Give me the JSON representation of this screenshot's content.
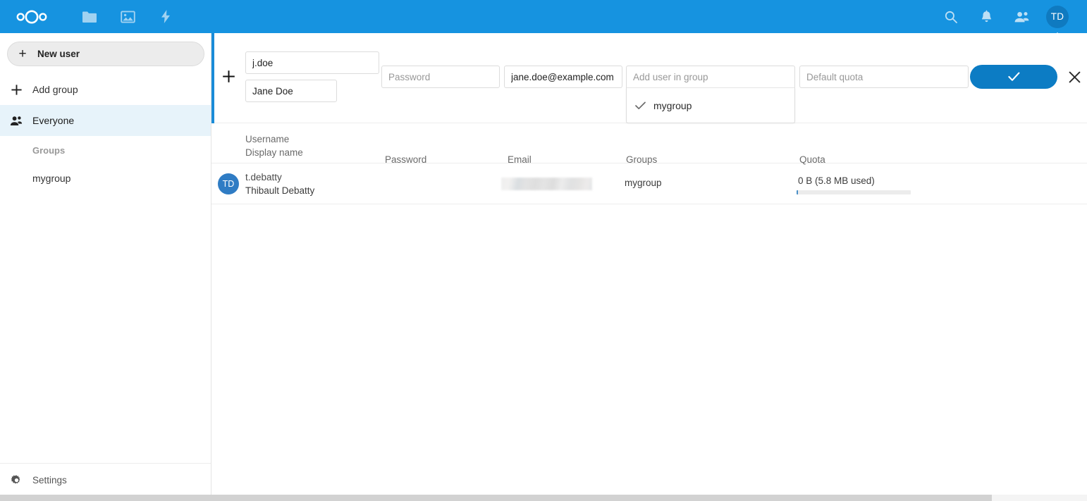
{
  "header": {
    "logo": "nextcloud-logo",
    "apps": [
      {
        "name": "files-app-icon",
        "label": "Files"
      },
      {
        "name": "photos-app-icon",
        "label": "Photos"
      },
      {
        "name": "activity-app-icon",
        "label": "Activity"
      }
    ],
    "actions": [
      {
        "name": "search-icon",
        "label": "Search"
      },
      {
        "name": "notifications-bell-icon",
        "label": "Notifications"
      },
      {
        "name": "contacts-icon",
        "label": "Contacts"
      }
    ],
    "avatar_initials": "TD"
  },
  "sidebar": {
    "new_user_label": "New user",
    "add_group_label": "Add group",
    "everyone_label": "Everyone",
    "groups_heading": "Groups",
    "groups": [
      {
        "label": "mygroup"
      }
    ],
    "settings_label": "Settings"
  },
  "form": {
    "username": {
      "value": "j.doe",
      "placeholder": "Username"
    },
    "displayname": {
      "value": "Jane Doe",
      "placeholder": "Display name"
    },
    "password": {
      "value": "",
      "placeholder": "Password"
    },
    "email": {
      "value": "jane.doe@example.com",
      "placeholder": "Email"
    },
    "group": {
      "value": "",
      "placeholder": "Add user in group"
    },
    "quota": {
      "value": "",
      "placeholder": "Default quota"
    },
    "dropdown_options": [
      {
        "label": "mygroup",
        "selected": true
      }
    ],
    "submit_icon": "check-icon",
    "close_icon": "close-icon"
  },
  "table": {
    "headers": {
      "username": "Username",
      "displayname": "Display name",
      "password": "Password",
      "email": "Email",
      "groups": "Groups",
      "quota": "Quota"
    },
    "rows": [
      {
        "avatar_initials": "TD",
        "username": "t.debatty",
        "displayname": "Thibault Debatty",
        "password": "",
        "email": "",
        "email_redacted": true,
        "groups": "mygroup",
        "quota_text": "0 B (5.8 MB used)",
        "quota_percent": 1
      }
    ]
  },
  "colors": {
    "header_blue": "#1693e0",
    "accent_blue": "#1a8cd8",
    "button_blue": "#0c7cc4",
    "avatar_blue": "#2f7cc4",
    "active_nav": "#e7f3fa"
  }
}
